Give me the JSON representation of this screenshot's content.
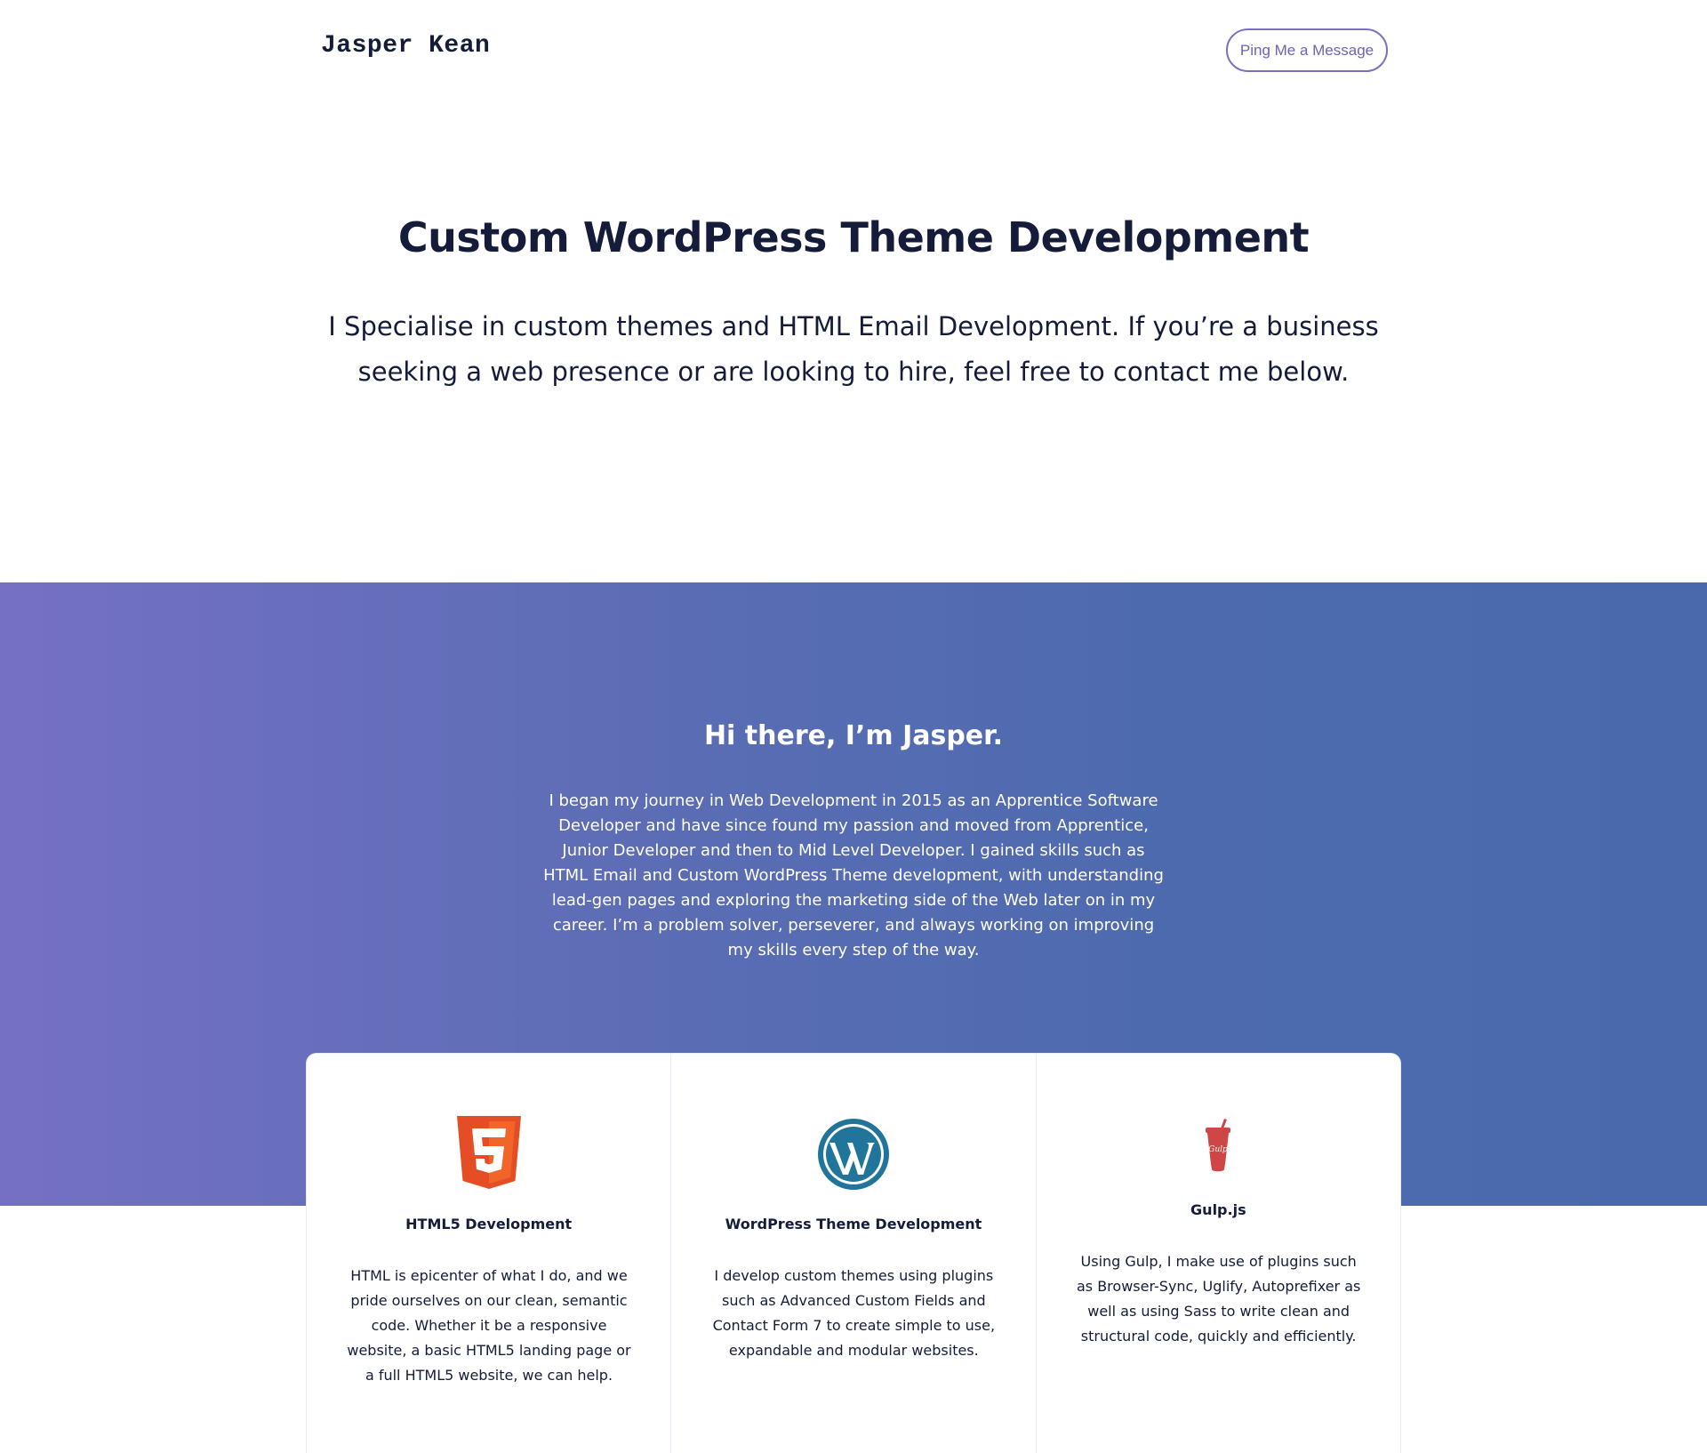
{
  "header": {
    "logo": "Jasper Kean",
    "cta_label": "Ping Me a Message"
  },
  "hero": {
    "title": "Custom WordPress Theme Development",
    "subtitle": "I Specialise in custom themes and HTML Email Development. If you’re a business seeking a web presence or are looking to hire, feel free to contact me below."
  },
  "about": {
    "title": "Hi there, I’m Jasper.",
    "text": "I began my journey in Web Development in 2015 as an Apprentice Software Developer and have since found my passion and moved from Apprentice, Junior Developer and then to Mid Level Developer. I gained skills such as HTML Email and Custom WordPress Theme development, with understanding lead-gen pages and exploring the marketing side of the Web later on in my career. I’m a problem solver, perseverer, and always working on improving my skills every step of the way."
  },
  "skills": [
    {
      "icon": "html5-icon",
      "title": "HTML5 Development",
      "text": "HTML is epicenter of what I do, and we pride ourselves on our clean, semantic code. Whether it be a responsive website, a basic HTML5 landing page or a full HTML5 website, we can help."
    },
    {
      "icon": "wordpress-icon",
      "title": "WordPress Theme Development",
      "text": "I develop custom themes using plugins such as Advanced Custom Fields and Contact Form 7 to create simple to use, expandable and modular websites."
    },
    {
      "icon": "gulp-icon",
      "icon_text": "Gulp",
      "title": "Gulp.js",
      "text": "Using Gulp, I make use of plugins such as Browser-Sync, Uglify, Autoprefixer as well as using Sass to write clean and structural code, quickly and efficiently."
    }
  ],
  "colors": {
    "primary_text": "#141c3a",
    "accent": "#7b6fc3",
    "band_start": "#7570c3",
    "band_end": "#4a69ad",
    "html5": "#e44d26",
    "wordpress": "#21759b",
    "gulp": "#cf4646"
  }
}
